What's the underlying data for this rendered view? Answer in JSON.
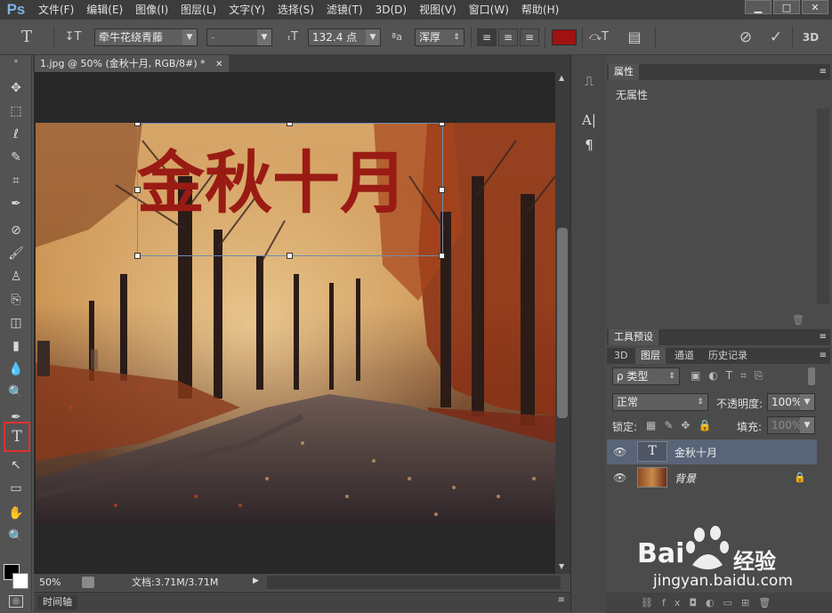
{
  "app": {
    "logo": "Ps"
  },
  "menu": [
    "文件(F)",
    "编辑(E)",
    "图像(I)",
    "图层(L)",
    "文字(Y)",
    "选择(S)",
    "滤镜(T)",
    "3D(D)",
    "视图(V)",
    "窗口(W)",
    "帮助(H)"
  ],
  "window_controls": {
    "minimize": "▁",
    "restore": "□",
    "close": "✕"
  },
  "options": {
    "tool_glyph": "T",
    "orient_glyph": "↧T",
    "font_family": "牵牛花绕青藤",
    "font_style": "-",
    "size_glyph": "ₜT",
    "font_size": "132.4 点",
    "aa_glyph": "ªa",
    "antialias": "浑厚",
    "align_left": "≡",
    "align_center": "≡",
    "align_right": "≡",
    "text_color": "#a01212",
    "warp_glyph": "⤼T",
    "panel_glyph": "▤",
    "cancel_glyph": "⊘",
    "commit_glyph": "✓",
    "mode3d": "3D"
  },
  "document": {
    "tab_title": "1.jpg @ 50% (金秋十月, RGB/8#) *",
    "tab_close": "✕",
    "canvas_text": "金秋十月",
    "zoom": "50%",
    "doc_info": "文档:3.71M/3.71M"
  },
  "toolbar": {
    "tools": [
      "✥",
      "⬚",
      "ℓ",
      "✎",
      "⌗",
      "✒",
      "⊘",
      "🖌",
      "♙",
      "⎘",
      "◫",
      "▮",
      "💧",
      "🔍",
      "✒",
      "T",
      "↖",
      "▭",
      "✋",
      "🔍"
    ]
  },
  "timeline": {
    "label": "时间轴"
  },
  "properties": {
    "title": "属性",
    "empty": "无属性"
  },
  "tool_presets": {
    "title": "工具预设"
  },
  "layers": {
    "tabs": [
      "3D",
      "图层",
      "通道",
      "历史记录"
    ],
    "active_tab": 1,
    "filter_label": "ρ 类型",
    "blend_mode": "正常",
    "opacity_label": "不透明度:",
    "opacity_value": "100%",
    "lock_label": "锁定:",
    "fill_label": "填充:",
    "fill_value": "100%",
    "items": [
      {
        "name": "金秋十月",
        "thumb": "T",
        "selected": true
      },
      {
        "name": "背景",
        "locked": true,
        "selected": false
      }
    ]
  },
  "watermark": {
    "brand": "Bai",
    "brand2": "经验",
    "url": "jingyan.baidu.com"
  }
}
